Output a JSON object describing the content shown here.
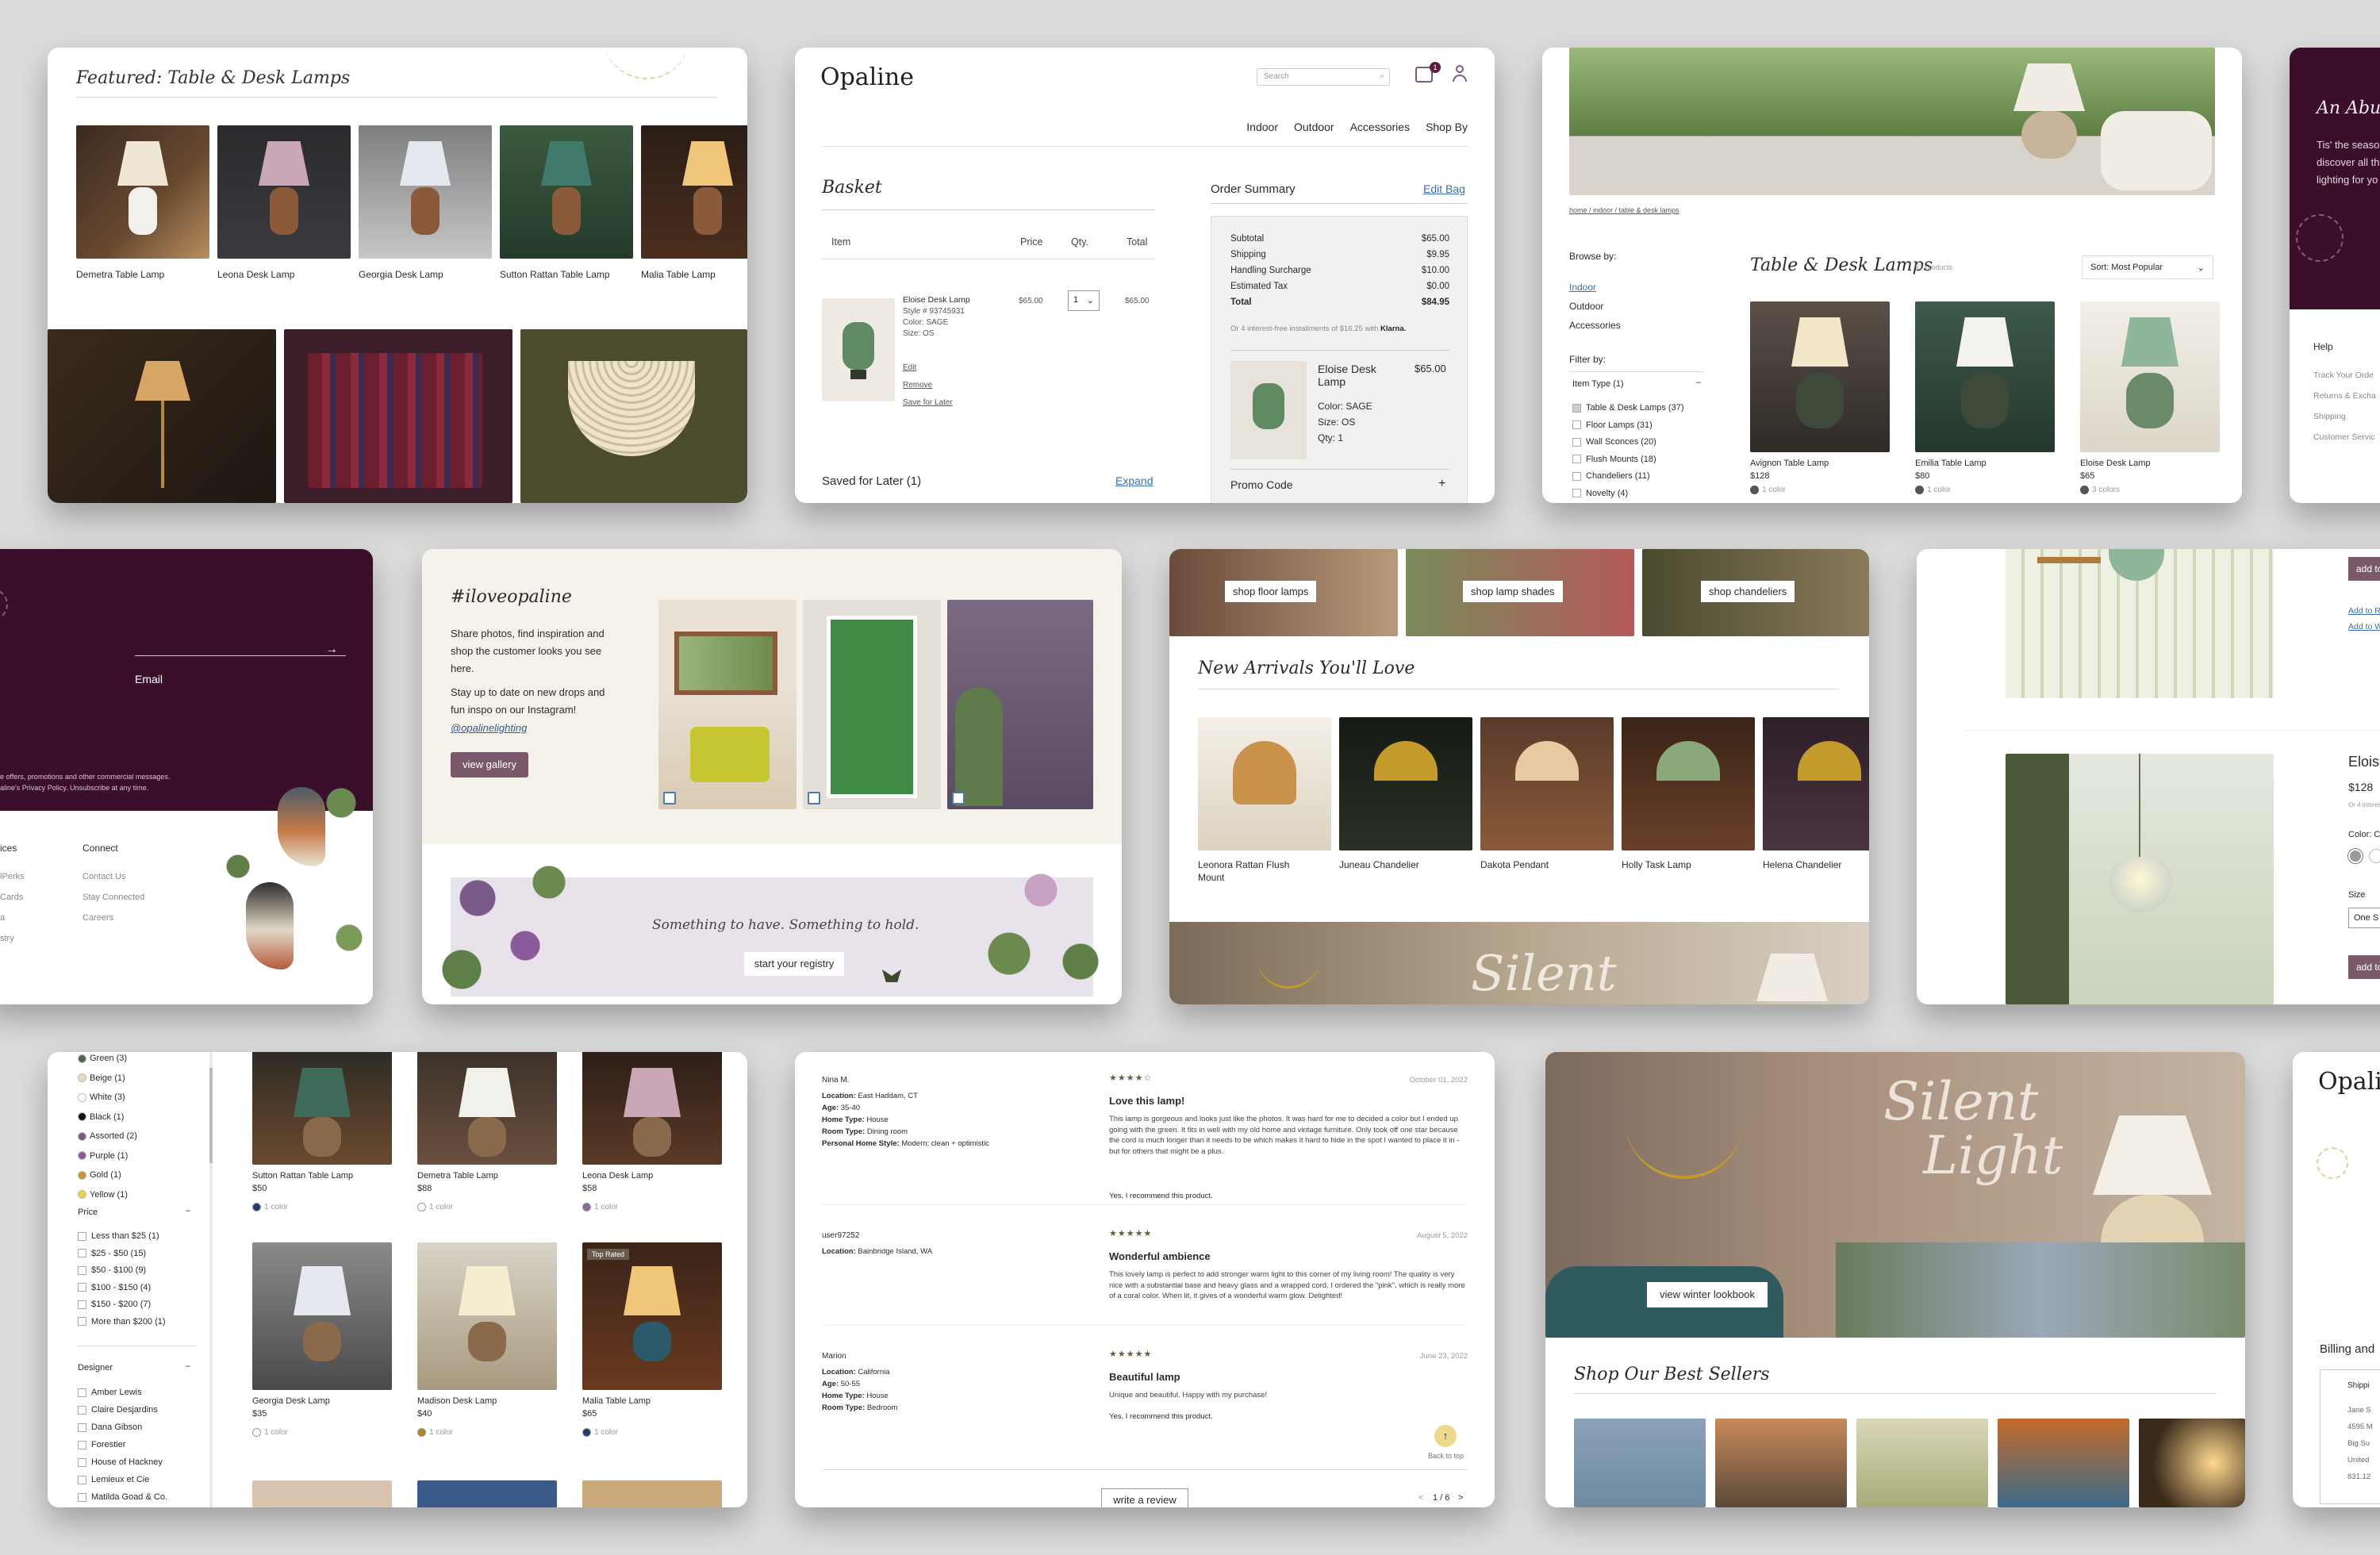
{
  "c1": {
    "title": "Featured: Table & Desk Lamps",
    "products": [
      "Demetra Table Lamp",
      "Leona Desk Lamp",
      "Georgia Desk Lamp",
      "Sutton Rattan Table Lamp",
      "Malia Table Lamp"
    ]
  },
  "c2": {
    "brand": "Opaline",
    "search_placeholder": "Search",
    "cart_count": "1",
    "nav": [
      "Indoor",
      "Outdoor",
      "Accessories",
      "Shop By"
    ],
    "basket_title": "Basket",
    "cols": {
      "item": "Item",
      "price": "Price",
      "qty": "Qty.",
      "total": "Total"
    },
    "item": {
      "name": "Eloise Desk Lamp",
      "style": "Style # 93745931",
      "color": "Color: SAGE",
      "size": "Size: OS",
      "price": "$65.00",
      "qty": "1",
      "total": "$65.00",
      "edit": "Edit",
      "remove": "Remove",
      "save": "Save for Later"
    },
    "saved": "Saved for Later (1)",
    "expand": "Expand",
    "summary": {
      "title": "Order Summary",
      "edit": "Edit Bag",
      "rows": [
        [
          "Subtotal",
          "$65.00"
        ],
        [
          "Shipping",
          "$9.95"
        ],
        [
          "Handling Surcharge",
          "$10.00"
        ],
        [
          "Estimated Tax",
          "$0.00"
        ],
        [
          "Total",
          "$84.95"
        ]
      ],
      "klarna": "Or 4 interest-free installments of $16.25 with",
      "klarna_brand": "Klarna.",
      "name": "Eloise Desk Lamp",
      "price": "$65.00",
      "color": "Color: SAGE",
      "size": "Size: OS",
      "qty": "Qty: 1",
      "promo": "Promo Code",
      "plus": "+"
    }
  },
  "c3": {
    "breadcrumb": "home / indoor / table & desk lamps",
    "browse": "Browse by:",
    "cats": [
      "Indoor",
      "Outdoor",
      "Accessories"
    ],
    "filter": "Filter by:",
    "type_title": "Item Type (1)",
    "types": [
      "Table & Desk Lamps (37)",
      "Floor Lamps (31)",
      "Wall Sconces (20)",
      "Flush Mounts (18)",
      "Chandeliers (11)",
      "Novelty (4)"
    ],
    "heading": "Table & Desk Lamps",
    "count": "37 products",
    "sort": "Sort: Most Popular",
    "products": [
      {
        "name": "Avignon Table Lamp",
        "price": "$128",
        "colors": "1 color"
      },
      {
        "name": "Emilia Table Lamp",
        "price": "$80",
        "colors": "1 color"
      },
      {
        "name": "Eloise Desk Lamp",
        "price": "$65",
        "colors": "3 colors"
      }
    ]
  },
  "c4": {
    "heading": "An Abun",
    "body": "Tis' the seaso discover all th lighting for yo",
    "help": "Help",
    "links": [
      "Track Your Orde",
      "Returns & Excha",
      "Shipping",
      "Customer Servic"
    ]
  },
  "c5": {
    "email": "Email",
    "arrow": "→",
    "legal1": "e offers, promotions and other commercial messages.",
    "legal2": "aline's Privacy Policy. Unsubscribe at any time.",
    "col1_title": "ices",
    "col1": [
      "lPerks",
      "Cards",
      "a",
      "stry"
    ],
    "col2_title": "Connect",
    "col2": [
      "Contact Us",
      "Stay Connected",
      "Careers"
    ]
  },
  "c6": {
    "heading": "#iloveopaline",
    "p1": "Share photos, find inspiration and shop the customer looks you see here.",
    "p2": "Stay up to date on new drops and fun inspo on our Instagram!",
    "handle": "@opalinelighting",
    "gallery_btn": "view gallery",
    "registry_text": "Something to have. Something to hold.",
    "registry_btn": "start your registry"
  },
  "c7": {
    "shop": [
      "shop floor lamps",
      "shop lamp shades",
      "shop chandeliers"
    ],
    "heading": "New Arrivals You'll Love",
    "products": [
      "Leonora Rattan Flush Mount",
      "Juneau Chandelier",
      "Dakota Pendant",
      "Holly Task Lamp",
      "Helena Chandelier"
    ],
    "banner": "Silent"
  },
  "c8": {
    "add1": "add to",
    "links": [
      "Add to R",
      "Add to W"
    ],
    "name": "Eloise",
    "price": "$128",
    "installments": "Or 4 interest",
    "color": "Color: C",
    "size": "Size",
    "size_val": "One S",
    "add2": "add to"
  },
  "c9": {
    "colors": [
      {
        "name": "Green (3)",
        "hex": "#4b6b4a"
      },
      {
        "name": "Beige (1)",
        "hex": "#e7dcc3"
      },
      {
        "name": "White (3)",
        "hex": "#ffffff"
      },
      {
        "name": "Black (1)",
        "hex": "#111111"
      },
      {
        "name": "Assorted (2)",
        "hex": "#7a5a8a"
      },
      {
        "name": "Purple (1)",
        "hex": "#8a5aa0"
      },
      {
        "name": "Gold (1)",
        "hex": "#c49a2b"
      },
      {
        "name": "Yellow (1)",
        "hex": "#e8d24a"
      }
    ],
    "price_title": "Price",
    "prices": [
      "Less than $25 (1)",
      "$25 - $50 (15)",
      "$50 - $100 (9)",
      "$100 - $150 (4)",
      "$150 - $200 (7)",
      "More than $200 (1)"
    ],
    "designer_title": "Designer",
    "designers": [
      "Amber Lewis",
      "Claire Desjardins",
      "Dana Gibson",
      "Forestier",
      "House of Hackney",
      "Lemieux et Cie",
      "Matilda Goad & Co."
    ],
    "products": [
      {
        "name": "Sutton Rattan Table Lamp",
        "price": "$50",
        "colors": "1 color",
        "sw": "#1f3f6b"
      },
      {
        "name": "Demetra Table Lamp",
        "price": "$88",
        "colors": "1 color",
        "sw": "#ffffff"
      },
      {
        "name": "Leona Desk Lamp",
        "price": "$58",
        "colors": "1 color",
        "sw": "#8a6a9a"
      },
      {
        "name": "Georgia Desk Lamp",
        "price": "$35",
        "colors": "1 color",
        "sw": "#ffffff"
      },
      {
        "name": "Madison Desk Lamp",
        "price": "$40",
        "colors": "1 color",
        "sw": "#b08a1a"
      },
      {
        "name": "Malia Table Lamp",
        "price": "$65",
        "colors": "1 color",
        "sw": "#1f3f6b"
      }
    ],
    "top_rated": "Top Rated"
  },
  "c10": {
    "reviews": [
      {
        "user": "Nina M.",
        "loc": "East Haddam, CT",
        "age": "35-40",
        "home": "House",
        "room": "Dining room",
        "style": "Modern; clean + optimistic",
        "stars": "★★★★☆",
        "date": "October 01, 2022",
        "title": "Love this lamp!",
        "body": "This lamp is gorgeous and looks just like the photos. It was hard for me to decided a color but I ended up going with the green. It fits in well with my old home and vintage furniture. Only took off one star because the cord is much longer than it needs to be which makes it hard to hide in the spot I wanted to place it in - but for others that might be a plus.",
        "rec": "Yes, I recommend this product."
      },
      {
        "user": "user97252",
        "loc": "Bainbridge Island, WA",
        "stars": "★★★★★",
        "date": "August 5, 2022",
        "title": "Wonderful ambience",
        "body": "This lovely lamp is perfect to add stronger warm light to this corner of my living room! The quality is very nice with a substantial base and heavy glass and a wrapped cord. I ordered the \"pink\", which is really more of a coral color. When lit, it gives of a wonderful warm glow. Delighted!"
      },
      {
        "user": "Marion",
        "loc": "California",
        "age": "50-55",
        "home": "House",
        "room": "Bedroom",
        "stars": "★★★★★",
        "date": "June 23, 2022",
        "title": "Beautiful lamp",
        "body": "Unique and beautiful. Happy with my purchase!",
        "rec": "Yes, I recommend this product."
      }
    ],
    "labels": {
      "loc": "Location:",
      "age": "Age:",
      "home": "Home Type:",
      "room": "Room Type:",
      "style": "Personal Home Style:"
    },
    "back": "Back to top",
    "write": "write a review",
    "pager": "1 / 6",
    "prev": "<",
    "next": ">"
  },
  "c11": {
    "banner1": "Silent",
    "banner2": "Light",
    "btn": "view winter lookbook",
    "heading": "Shop Our Best Sellers"
  },
  "c12": {
    "brand": "Opalin",
    "billing": "Billing and",
    "ship": "Shippi",
    "addr": [
      "Jane S",
      "4595 M",
      "Big Su",
      "United",
      "831.12"
    ]
  }
}
